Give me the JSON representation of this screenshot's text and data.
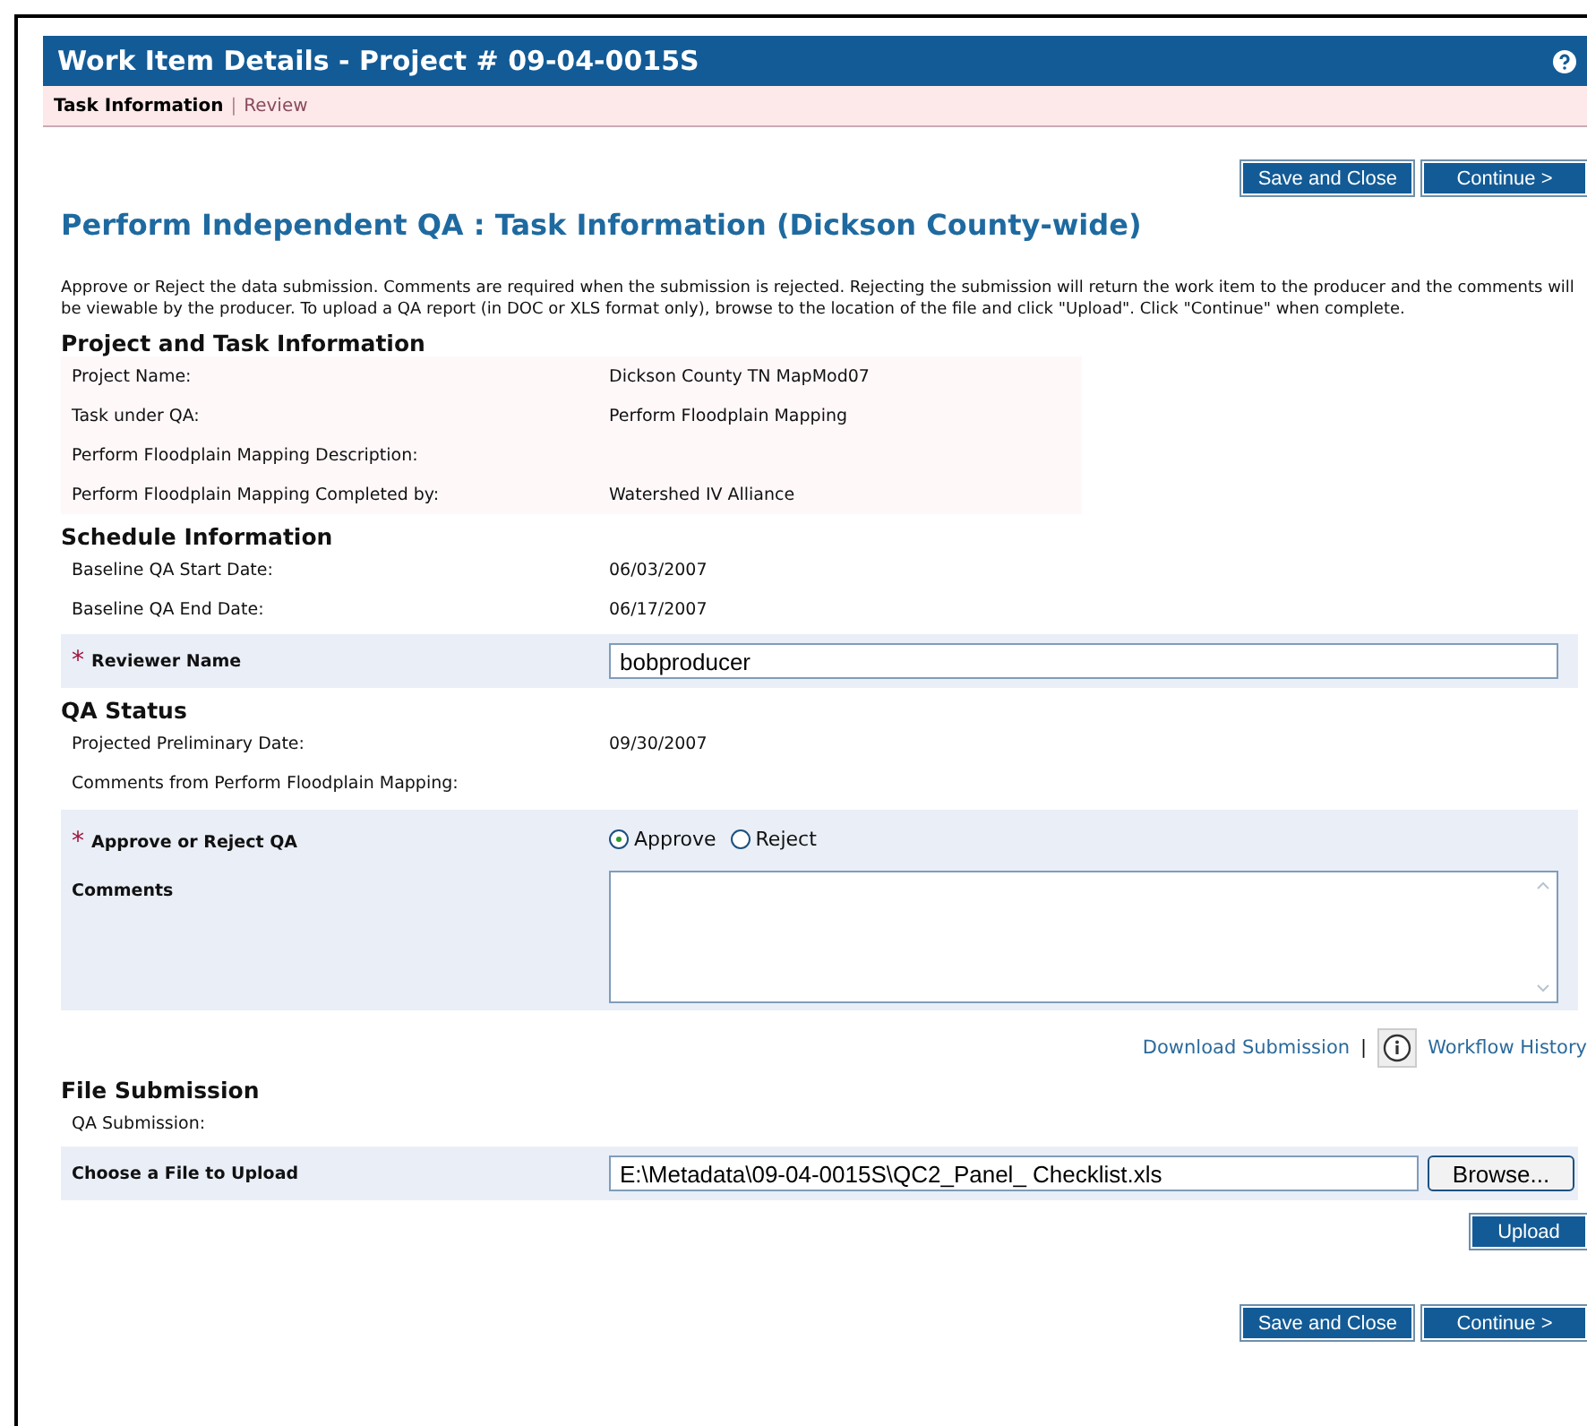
{
  "window": {
    "title": "Work Item Details - Project # 09-04-0015S"
  },
  "tab_separator": "|",
  "tabs": [
    {
      "label": "Task Information",
      "selected": true
    },
    {
      "label": "Review",
      "selected": false
    }
  ],
  "top_buttons": [
    "Save and Close",
    "Continue >"
  ],
  "heading": "Perform Independent QA : Task Information (Dickson County-wide)",
  "intro": "Approve or Reject the data submission. Comments are required when the submission is rejected. Rejecting the submission will return the work item to the producer and the comments will be viewable by the producer. To upload a QA report (in DOC or XLS format only), browse to the location of the file and click \"Upload\". Click \"Continue\" when complete.",
  "project_task": {
    "title": "Project and Task Information",
    "rows": [
      {
        "label": "Project Name:",
        "value": "Dickson County TN MapMod07"
      },
      {
        "label": "Task under QA:",
        "value": "Perform Floodplain Mapping"
      },
      {
        "label": "Perform Floodplain Mapping Description:",
        "value": ""
      },
      {
        "label": "Perform Floodplain Mapping Completed by:",
        "value": "Watershed IV Alliance"
      }
    ]
  },
  "schedule": {
    "title": "Schedule Information",
    "rows": [
      {
        "label": "Baseline QA Start Date:",
        "value": "06/03/2007"
      },
      {
        "label": "Baseline QA End Date:",
        "value": "06/17/2007"
      }
    ]
  },
  "reviewer": {
    "required_mark": "*",
    "label": "Reviewer Name",
    "value": "bobproducer"
  },
  "qa_status": {
    "title": "QA Status",
    "rows": [
      {
        "label": "Projected Preliminary Date:",
        "value": "09/30/2007"
      },
      {
        "label": "Comments from Perform Floodplain Mapping:",
        "value": ""
      }
    ]
  },
  "approve": {
    "required_mark": "*",
    "label": "Approve or Reject QA",
    "options": [
      {
        "label": "Approve",
        "selected": true
      },
      {
        "label": "Reject",
        "selected": false
      }
    ]
  },
  "comments": {
    "label": "Comments"
  },
  "links": {
    "download": "Download Submission",
    "separator": "|",
    "history": "Workflow History"
  },
  "file_submission": {
    "title": "File Submission",
    "rows": [
      {
        "label": "QA Submission:",
        "value": ""
      }
    ],
    "upload": {
      "label": "Choose a File to Upload",
      "value": "E:\\Metadata\\09-04-0015S\\QC2_Panel_ Checklist.xls",
      "browse": "Browse..."
    },
    "upload_button": "Upload"
  },
  "bottom_buttons": [
    "Save and Close",
    "Continue >"
  ]
}
